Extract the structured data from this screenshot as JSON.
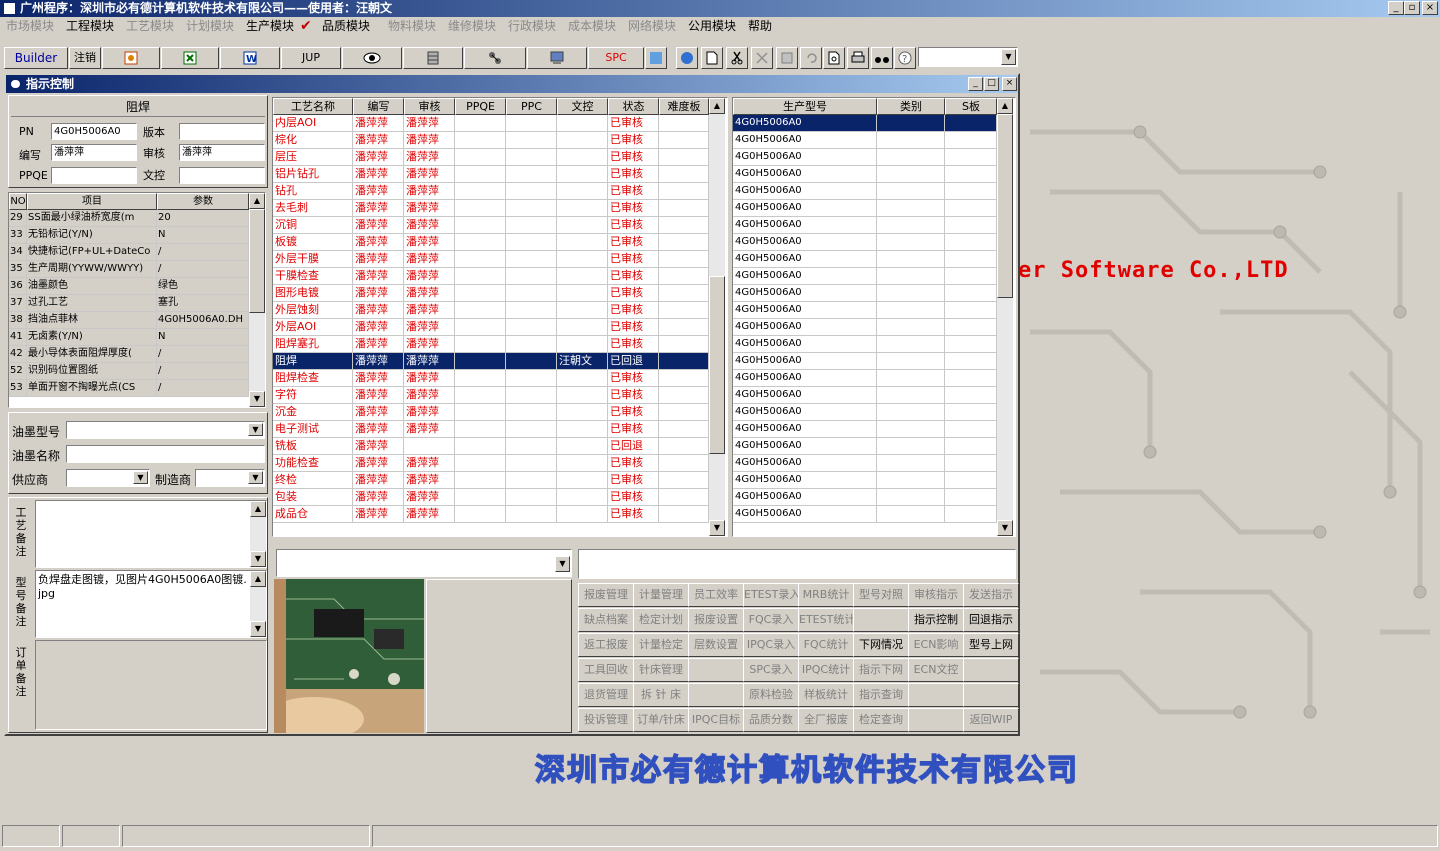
{
  "app": {
    "title": "广州程序：深圳市必有德计算机软件技术有限公司——使用者：汪朝文",
    "window_buttons": [
      "_",
      "▫",
      "×"
    ]
  },
  "menu": [
    {
      "label": "市场模块",
      "enabled": false
    },
    {
      "label": "工程模块",
      "enabled": true
    },
    {
      "label": "工艺模块",
      "enabled": false
    },
    {
      "label": "计划模块",
      "enabled": false
    },
    {
      "label": "生产模块",
      "enabled": true
    },
    {
      "label": "品质模块",
      "enabled": true
    },
    {
      "label": "物料模块",
      "enabled": false
    },
    {
      "label": "维修模块",
      "enabled": false
    },
    {
      "label": "行政模块",
      "enabled": false
    },
    {
      "label": "成本模块",
      "enabled": false
    },
    {
      "label": "网络模块",
      "enabled": false
    },
    {
      "label": "公用模块",
      "enabled": true
    },
    {
      "label": "帮助",
      "enabled": true
    }
  ],
  "toolbar": {
    "builder": "Builder",
    "logout": "注销",
    "jup": "JUP",
    "spc": "SPC"
  },
  "background": {
    "software_text": "er Software Co.,LTD",
    "company_text": "深圳市必有德计算机软件技术有限公司"
  },
  "child": {
    "title": "指示控制",
    "buttons": [
      "_",
      "□",
      "×"
    ]
  },
  "form": {
    "process_name": "阻焊",
    "pn_label": "PN",
    "pn_value": "4G0H5006A0",
    "version_label": "版本",
    "version_value": "",
    "author_label": "编写",
    "author_value": "潘萍萍",
    "review_label": "审核",
    "review_value": "潘萍萍",
    "ppqe_label": "PPQE",
    "ppqe_value": "",
    "wenkong_label": "文控",
    "wenkong_value": ""
  },
  "params": {
    "headers": [
      "NO",
      "项目",
      "参数"
    ],
    "rows": [
      [
        "29",
        "SS面最小绿油桥宽度(m",
        "20"
      ],
      [
        "33",
        "无铅标记(Y/N)",
        "N"
      ],
      [
        "34",
        "快捷标记(FP+UL+DateCo",
        "/"
      ],
      [
        "35",
        "生产周期(YYWW/WWYY)",
        "/"
      ],
      [
        "36",
        "油墨颜色",
        "绿色"
      ],
      [
        "37",
        "过孔工艺",
        "塞孔"
      ],
      [
        "38",
        "挡油点菲林",
        "4G0H5006A0.DH"
      ],
      [
        "41",
        "无卤素(Y/N)",
        "N"
      ],
      [
        "42",
        "最小导体表面阻焊厚度(",
        "/"
      ],
      [
        "52",
        "识别码位置图纸",
        "/"
      ],
      [
        "53",
        "单面开窗不掏曝光点(CS",
        "/"
      ]
    ]
  },
  "ink": {
    "type_label": "油墨型号",
    "type_value": "",
    "name_label": "油墨名称",
    "name_value": "",
    "supplier_label": "供应商",
    "supplier_value": "",
    "maker_label": "制造商",
    "maker_value": ""
  },
  "notes": {
    "process_label": "工艺备注",
    "process_value": "",
    "model_label": "型号备注",
    "model_value": "负焊盘走图镀，见图片4G0H5006A0图镀.jpg",
    "order_label": "订单备注",
    "order_value": ""
  },
  "process_grid": {
    "headers": [
      "工艺名称",
      "编写",
      "审核",
      "PPQE",
      "PPC",
      "文控",
      "状态",
      "难度板"
    ],
    "rows": [
      [
        "内层AOI",
        "潘萍萍",
        "潘萍萍",
        "",
        "",
        "",
        "已审核",
        ""
      ],
      [
        "棕化",
        "潘萍萍",
        "潘萍萍",
        "",
        "",
        "",
        "已审核",
        ""
      ],
      [
        "层压",
        "潘萍萍",
        "潘萍萍",
        "",
        "",
        "",
        "已审核",
        ""
      ],
      [
        "铝片钻孔",
        "潘萍萍",
        "潘萍萍",
        "",
        "",
        "",
        "已审核",
        ""
      ],
      [
        "钻孔",
        "潘萍萍",
        "潘萍萍",
        "",
        "",
        "",
        "已审核",
        ""
      ],
      [
        "去毛刺",
        "潘萍萍",
        "潘萍萍",
        "",
        "",
        "",
        "已审核",
        ""
      ],
      [
        "沉铜",
        "潘萍萍",
        "潘萍萍",
        "",
        "",
        "",
        "已审核",
        ""
      ],
      [
        "板镀",
        "潘萍萍",
        "潘萍萍",
        "",
        "",
        "",
        "已审核",
        ""
      ],
      [
        "外层干膜",
        "潘萍萍",
        "潘萍萍",
        "",
        "",
        "",
        "已审核",
        ""
      ],
      [
        "干膜检查",
        "潘萍萍",
        "潘萍萍",
        "",
        "",
        "",
        "已审核",
        ""
      ],
      [
        "图形电镀",
        "潘萍萍",
        "潘萍萍",
        "",
        "",
        "",
        "已审核",
        ""
      ],
      [
        "外层蚀刻",
        "潘萍萍",
        "潘萍萍",
        "",
        "",
        "",
        "已审核",
        ""
      ],
      [
        "外层AOI",
        "潘萍萍",
        "潘萍萍",
        "",
        "",
        "",
        "已审核",
        ""
      ],
      [
        "阻焊塞孔",
        "潘萍萍",
        "潘萍萍",
        "",
        "",
        "",
        "已审核",
        ""
      ],
      [
        "阻焊",
        "潘萍萍",
        "潘萍萍",
        "",
        "",
        "汪朝文",
        "已回退",
        ""
      ],
      [
        "阻焊检查",
        "潘萍萍",
        "潘萍萍",
        "",
        "",
        "",
        "已审核",
        ""
      ],
      [
        "字符",
        "潘萍萍",
        "潘萍萍",
        "",
        "",
        "",
        "已审核",
        ""
      ],
      [
        "沉金",
        "潘萍萍",
        "潘萍萍",
        "",
        "",
        "",
        "已审核",
        ""
      ],
      [
        "电子测试",
        "潘萍萍",
        "潘萍萍",
        "",
        "",
        "",
        "已审核",
        ""
      ],
      [
        "铣板",
        "潘萍萍",
        "",
        "",
        "",
        "",
        "已回退",
        ""
      ],
      [
        "功能检查",
        "潘萍萍",
        "潘萍萍",
        "",
        "",
        "",
        "已审核",
        ""
      ],
      [
        "终检",
        "潘萍萍",
        "潘萍萍",
        "",
        "",
        "",
        "已审核",
        ""
      ],
      [
        "包装",
        "潘萍萍",
        "潘萍萍",
        "",
        "",
        "",
        "已审核",
        ""
      ],
      [
        "成品仓",
        "潘萍萍",
        "潘萍萍",
        "",
        "",
        "",
        "已审核",
        ""
      ]
    ],
    "selected_index": 14
  },
  "model_grid": {
    "headers": [
      "生产型号",
      "类别",
      "S板"
    ],
    "rows": [
      "4G0H5006A0",
      "4G0H5006A0",
      "4G0H5006A0",
      "4G0H5006A0",
      "4G0H5006A0",
      "4G0H5006A0",
      "4G0H5006A0",
      "4G0H5006A0",
      "4G0H5006A0",
      "4G0H5006A0",
      "4G0H5006A0",
      "4G0H5006A0",
      "4G0H5006A0",
      "4G0H5006A0",
      "4G0H5006A0",
      "4G0H5006A0",
      "4G0H5006A0",
      "4G0H5006A0",
      "4G0H5006A0",
      "4G0H5006A0",
      "4G0H5006A0",
      "4G0H5006A0",
      "4G0H5006A0",
      "4G0H5006A0"
    ],
    "selected_index": 0
  },
  "action_buttons": [
    [
      {
        "l": "报废管理",
        "e": false
      },
      {
        "l": "计量管理",
        "e": false
      },
      {
        "l": "员工效率",
        "e": false
      },
      {
        "l": "ETEST录入",
        "e": false
      },
      {
        "l": "MRB统计",
        "e": false
      },
      {
        "l": "型号对照",
        "e": false
      },
      {
        "l": "审核指示",
        "e": false
      },
      {
        "l": "发送指示",
        "e": false
      }
    ],
    [
      {
        "l": "缺点档案",
        "e": false
      },
      {
        "l": "检定计划",
        "e": false
      },
      {
        "l": "报废设置",
        "e": false
      },
      {
        "l": "FQC录入",
        "e": false
      },
      {
        "l": "ETEST统计",
        "e": false
      },
      {
        "l": "",
        "e": false
      },
      {
        "l": "指示控制",
        "e": true
      },
      {
        "l": "回退指示",
        "e": true
      }
    ],
    [
      {
        "l": "返工报废",
        "e": false
      },
      {
        "l": "计量检定",
        "e": false
      },
      {
        "l": "层数设置",
        "e": false
      },
      {
        "l": "IPQC录入",
        "e": false
      },
      {
        "l": "FQC统计",
        "e": false
      },
      {
        "l": "下网情况",
        "e": true
      },
      {
        "l": "ECN影响",
        "e": false
      },
      {
        "l": "型号上网",
        "e": true
      }
    ],
    [
      {
        "l": "工具回收",
        "e": false
      },
      {
        "l": "针床管理",
        "e": false
      },
      {
        "l": "",
        "e": false
      },
      {
        "l": "SPC录入",
        "e": false
      },
      {
        "l": "IPQC统计",
        "e": false
      },
      {
        "l": "指示下网",
        "e": false
      },
      {
        "l": "ECN文控",
        "e": false
      },
      {
        "l": "",
        "e": false
      }
    ],
    [
      {
        "l": "退货管理",
        "e": false
      },
      {
        "l": "拆 针 床",
        "e": false
      },
      {
        "l": "",
        "e": false
      },
      {
        "l": "原料检验",
        "e": false
      },
      {
        "l": "样板统计",
        "e": false
      },
      {
        "l": "指示查询",
        "e": false
      },
      {
        "l": "",
        "e": false
      },
      {
        "l": "",
        "e": false
      }
    ],
    [
      {
        "l": "投诉管理",
        "e": false
      },
      {
        "l": "订单/针床",
        "e": false
      },
      {
        "l": "IPQC目标",
        "e": false
      },
      {
        "l": "品质分数",
        "e": false
      },
      {
        "l": "全厂报废",
        "e": false
      },
      {
        "l": "检定查询",
        "e": false
      },
      {
        "l": "",
        "e": false
      },
      {
        "l": "返回WIP",
        "e": false
      }
    ]
  ],
  "colors": {
    "title_start": "#0a246a",
    "title_end": "#a6caf0",
    "text_red": "#e00000",
    "selection": "#0a246a",
    "face": "#d4d0c8"
  }
}
